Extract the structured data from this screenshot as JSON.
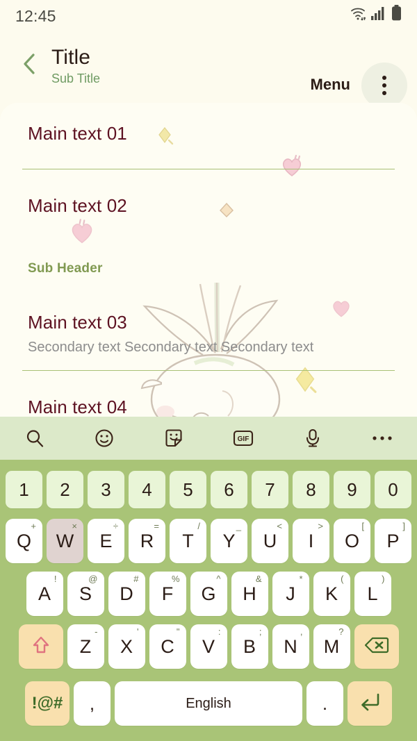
{
  "statusbar": {
    "clock": "12:45",
    "icons": [
      "wifi-icon",
      "signal-icon",
      "battery-icon"
    ]
  },
  "appbar": {
    "back_icon": "chevron-left-icon",
    "title": "Title",
    "subtitle": "Sub Title",
    "menu_label": "Menu",
    "overflow_icon": "more-vertical-icon",
    "overflow_bg": "#eef0e2"
  },
  "content": {
    "background": "#fefdf3",
    "divider_color": "#a8c075",
    "main_text_color": "#5d1222",
    "secondary_text_color": "#8c8c8c",
    "sub_header_color": "#819a52",
    "items": [
      {
        "main": "Main text 01",
        "secondary": ""
      },
      {
        "main": "Main text 02",
        "secondary": ""
      },
      {
        "main": "Main text 03",
        "secondary": "Secondary text Secondary text Secondary text"
      },
      {
        "main": "Main text 04",
        "secondary": ""
      }
    ],
    "sub_header": "Sub Header",
    "decorations": [
      "diamond-sparkle-icon",
      "heart-icon",
      "heart-icon",
      "heart-icon",
      "diamond-sparkle-icon",
      "turnip-illustration"
    ]
  },
  "keyboard": {
    "background": "#a9c477",
    "toolbar_background": "#dce9c9",
    "key_background": "#ffffff",
    "number_key_background": "#e9f5d7",
    "function_key_background": "#f9e0ae",
    "pressed_key_background": "#e0d3d0",
    "toolbar": [
      {
        "name": "search-icon",
        "label": ""
      },
      {
        "name": "emoji-icon",
        "label": ""
      },
      {
        "name": "sticker-icon",
        "label": ""
      },
      {
        "name": "gif-icon",
        "label": "GIF"
      },
      {
        "name": "microphone-icon",
        "label": ""
      },
      {
        "name": "more-horizontal-icon",
        "label": ""
      }
    ],
    "row_numbers": [
      {
        "main": "1"
      },
      {
        "main": "2"
      },
      {
        "main": "3"
      },
      {
        "main": "4"
      },
      {
        "main": "5"
      },
      {
        "main": "6"
      },
      {
        "main": "7"
      },
      {
        "main": "8"
      },
      {
        "main": "9"
      },
      {
        "main": "0"
      }
    ],
    "row_1": [
      {
        "main": "Q",
        "sup": "+"
      },
      {
        "main": "W",
        "sup": "×",
        "pressed": true
      },
      {
        "main": "E",
        "sup": "÷"
      },
      {
        "main": "R",
        "sup": "="
      },
      {
        "main": "T",
        "sup": "/"
      },
      {
        "main": "Y",
        "sup": "_"
      },
      {
        "main": "U",
        "sup": "<"
      },
      {
        "main": "I",
        "sup": ">"
      },
      {
        "main": "O",
        "sup": "["
      },
      {
        "main": "P",
        "sup": "]"
      }
    ],
    "row_2": [
      {
        "main": "A",
        "sup": "!"
      },
      {
        "main": "S",
        "sup": "@"
      },
      {
        "main": "D",
        "sup": "#"
      },
      {
        "main": "F",
        "sup": "%"
      },
      {
        "main": "G",
        "sup": "^"
      },
      {
        "main": "H",
        "sup": "&"
      },
      {
        "main": "J",
        "sup": "*"
      },
      {
        "main": "K",
        "sup": "("
      },
      {
        "main": "L",
        "sup": ")"
      }
    ],
    "row_3": [
      {
        "main": "Z",
        "sup": "-"
      },
      {
        "main": "X",
        "sup": "'"
      },
      {
        "main": "C",
        "sup": "\""
      },
      {
        "main": "V",
        "sup": ":"
      },
      {
        "main": "B",
        "sup": ";"
      },
      {
        "main": "N",
        "sup": ","
      },
      {
        "main": "M",
        "sup": "?"
      }
    ],
    "shift_icon": "shift-arrow-up-icon",
    "backspace_icon": "backspace-delete-icon",
    "symbols_label": "!@#",
    "comma_label": ",",
    "space_label": "English",
    "period_label": ".",
    "enter_icon": "enter-return-icon"
  }
}
